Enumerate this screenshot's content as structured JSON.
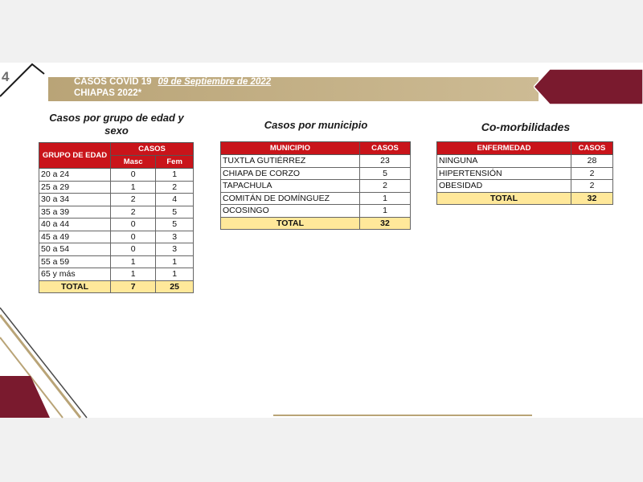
{
  "page_number": "4",
  "header": {
    "line1": "CASOS COVID 19",
    "date": "09 de Septiembre de 2022",
    "line2": "CHIAPAS 2022*"
  },
  "colors": {
    "maroon": "#7a1a2e",
    "gold": "#b9a477",
    "header_red": "#c9141a",
    "total_yellow": "#ffe89a"
  },
  "age_table": {
    "title": "Casos por grupo de edad y sexo",
    "col_group": "GRUPO DE EDAD",
    "col_cases": "CASOS",
    "col_masc": "Masc",
    "col_fem": "Fem",
    "rows": [
      {
        "group": "20 a 24",
        "masc": "0",
        "fem": "1"
      },
      {
        "group": "25 a 29",
        "masc": "1",
        "fem": "2"
      },
      {
        "group": "30 a 34",
        "masc": "2",
        "fem": "4"
      },
      {
        "group": "35 a 39",
        "masc": "2",
        "fem": "5"
      },
      {
        "group": "40 a 44",
        "masc": "0",
        "fem": "5"
      },
      {
        "group": "45 a 49",
        "masc": "0",
        "fem": "3"
      },
      {
        "group": "50 a 54",
        "masc": "0",
        "fem": "3"
      },
      {
        "group": "55 a 59",
        "masc": "1",
        "fem": "1"
      },
      {
        "group": "65 y más",
        "masc": "1",
        "fem": "1"
      }
    ],
    "total_label": "TOTAL",
    "total_masc": "7",
    "total_fem": "25"
  },
  "municipio_table": {
    "title": "Casos por municipio",
    "col_municipio": "MUNICIPIO",
    "col_cases": "CASOS",
    "rows": [
      {
        "name": "TUXTLA GUTIÉRREZ",
        "cases": "23"
      },
      {
        "name": "CHIAPA DE CORZO",
        "cases": "5"
      },
      {
        "name": "TAPACHULA",
        "cases": "2"
      },
      {
        "name": "COMITÁN DE DOMÍNGUEZ",
        "cases": "1"
      },
      {
        "name": "OCOSINGO",
        "cases": "1"
      }
    ],
    "total_label": "TOTAL",
    "total_cases": "32"
  },
  "comorb_table": {
    "title": "Co-morbilidades",
    "col_disease": "ENFERMEDAD",
    "col_cases": "CASOS",
    "rows": [
      {
        "name": "NINGUNA",
        "cases": "28"
      },
      {
        "name": "HIPERTENSIÓN",
        "cases": "2"
      },
      {
        "name": "OBESIDAD",
        "cases": "2"
      }
    ],
    "total_label": "TOTAL",
    "total_cases": "32"
  }
}
